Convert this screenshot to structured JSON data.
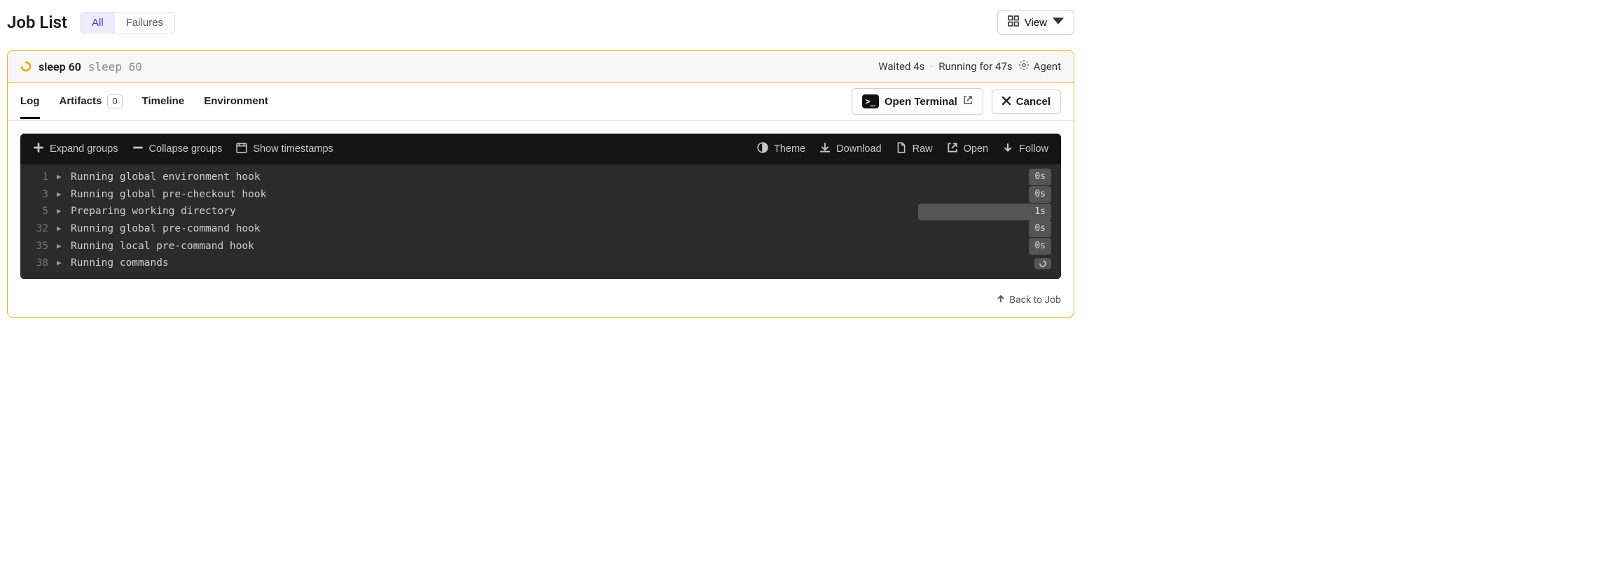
{
  "header": {
    "title": "Job List",
    "filters": {
      "all": "All",
      "failures": "Failures"
    },
    "view_label": "View"
  },
  "job": {
    "name": "sleep 60",
    "command": "sleep 60",
    "waited": "Waited 4s",
    "running": "Running for 47s",
    "agent_label": "Agent",
    "tabs": {
      "log": "Log",
      "artifacts": "Artifacts",
      "artifacts_count": "0",
      "timeline": "Timeline",
      "environment": "Environment"
    },
    "actions": {
      "open_terminal": "Open Terminal",
      "cancel": "Cancel"
    }
  },
  "log_toolbar": {
    "expand": "Expand groups",
    "collapse": "Collapse groups",
    "timestamps": "Show timestamps",
    "theme": "Theme",
    "download": "Download",
    "raw": "Raw",
    "open": "Open",
    "follow": "Follow"
  },
  "log_lines": [
    {
      "n": "1",
      "text": "Running global environment hook",
      "dur": "0s",
      "wide": false,
      "spinner": false
    },
    {
      "n": "3",
      "text": "Running global pre-checkout hook",
      "dur": "0s",
      "wide": false,
      "spinner": false
    },
    {
      "n": "5",
      "text": "Preparing working directory",
      "dur": "1s",
      "wide": true,
      "spinner": false
    },
    {
      "n": "32",
      "text": "Running global pre-command hook",
      "dur": "0s",
      "wide": false,
      "spinner": false
    },
    {
      "n": "35",
      "text": "Running local pre-command hook",
      "dur": "0s",
      "wide": false,
      "spinner": false
    },
    {
      "n": "38",
      "text": "Running commands",
      "dur": "",
      "wide": false,
      "spinner": true
    }
  ],
  "footer": {
    "back": "Back to Job"
  }
}
